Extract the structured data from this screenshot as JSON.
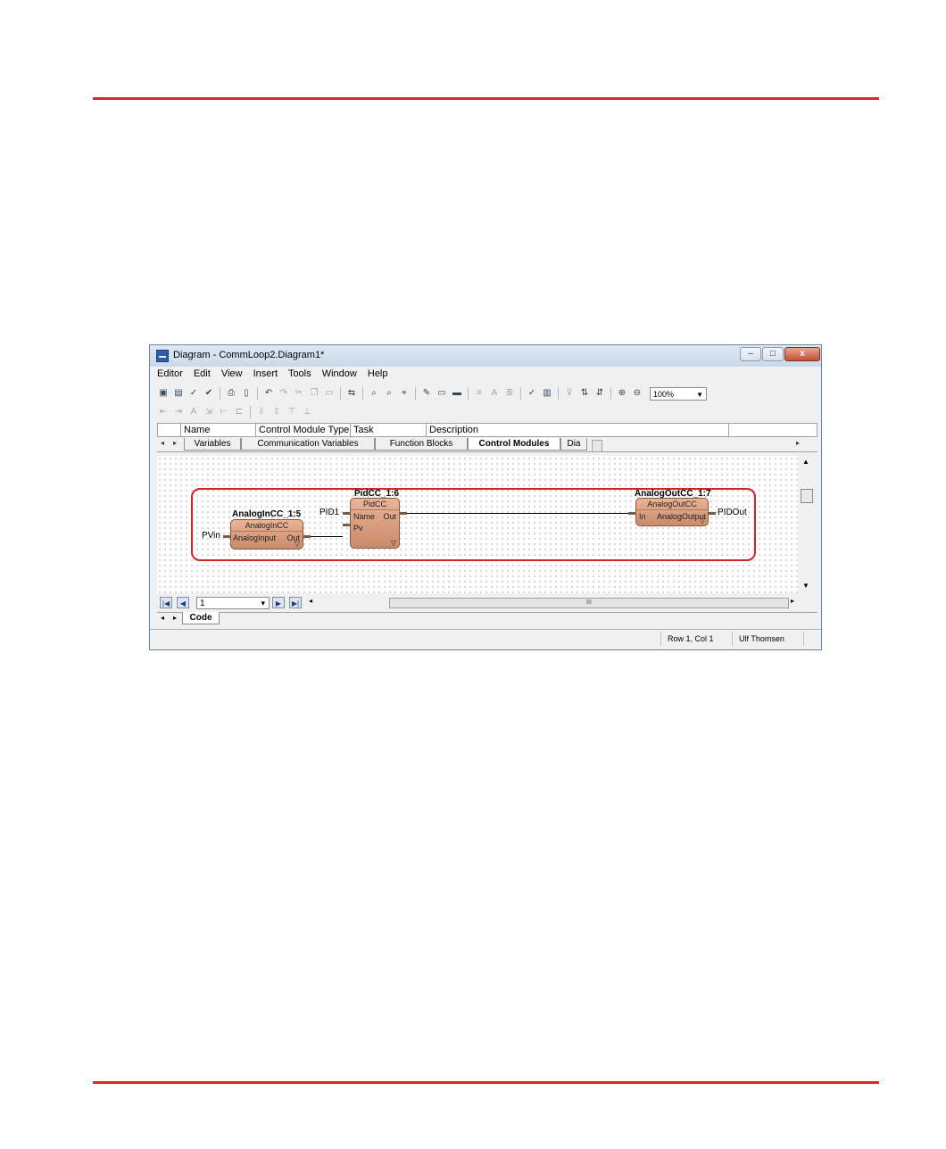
{
  "window": {
    "title": "Diagram - CommLoop2.Diagram1*",
    "buttons": {
      "minimize": "–",
      "maximize": "□",
      "close": "x"
    }
  },
  "menu": [
    "Editor",
    "Edit",
    "View",
    "Insert",
    "Tools",
    "Window",
    "Help"
  ],
  "toolbar": {
    "zoom": "100%"
  },
  "grid": {
    "columns": [
      "Name",
      "Control Module Type",
      "Task Connection",
      "Description"
    ]
  },
  "tabs": [
    "Variables",
    "Communication Variables",
    "Function Blocks",
    "Control Modules",
    "Dia"
  ],
  "active_tab": "Control Modules",
  "diagram": {
    "blocks": [
      {
        "name": "AnalogInCC_1:5",
        "type": "AnalogInCC",
        "inputs": [
          "AnalogInput"
        ],
        "outputs": [
          "Out"
        ]
      },
      {
        "name": "PidCC_1:6",
        "type": "PidCC",
        "inputs": [
          "Name",
          "Pv"
        ],
        "outputs": [
          "Out"
        ]
      },
      {
        "name": "AnalogOutCC_1:7",
        "type": "AnalogOutCC",
        "inputs": [
          "In"
        ],
        "outputs": [
          "AnalogOutput"
        ]
      }
    ],
    "labels": {
      "pvin": "PVin",
      "pid1": "PID1",
      "pidout": "PIDOut"
    }
  },
  "pager": {
    "page": "1",
    "scroll_mark": "III"
  },
  "code_tab": "Code",
  "status": {
    "position": "Row 1, Col 1",
    "user": "Ulf Thomsen"
  },
  "colors": {
    "rule": "#e0242a",
    "highlight": "#d42027",
    "block_fill": "#d99c7d"
  }
}
